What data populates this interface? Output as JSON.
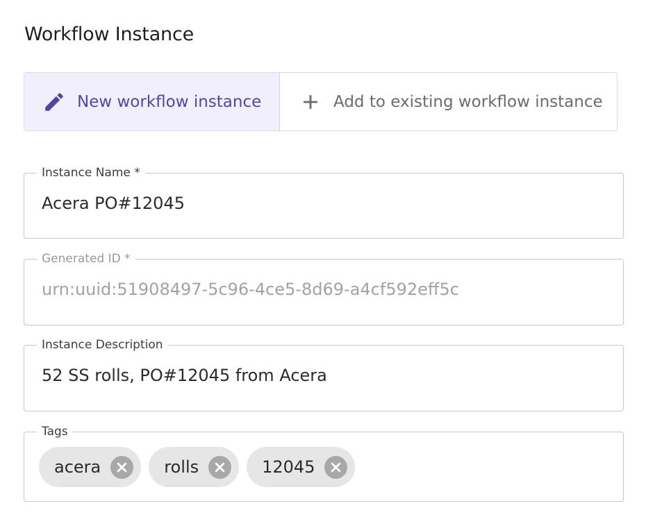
{
  "section": {
    "title": "Workflow Instance"
  },
  "mode_toggle": {
    "new_label": "New workflow instance",
    "existing_label": "Add to existing workflow instance",
    "selected": "new"
  },
  "fields": {
    "instance_name": {
      "label": "Instance Name *",
      "value": "Acera PO#12045"
    },
    "generated_id": {
      "label": "Generated ID *",
      "value": "urn:uuid:51908497-5c96-4ce5-8d69-a4cf592eff5c"
    },
    "instance_description": {
      "label": "Instance Description",
      "value": "52 SS rolls, PO#12045 from Acera"
    },
    "tags": {
      "label": "Tags",
      "items": [
        "acera",
        "rolls",
        "12045"
      ]
    }
  },
  "colors": {
    "accent": "#5644a4",
    "selected_bg": "#f1effb",
    "chip_bg": "#e6e6e6",
    "chip_delete": "#a8a8a8"
  },
  "icons": {
    "new": "pencil-icon",
    "existing": "plus-icon",
    "chip_delete": "cancel-circle-icon"
  }
}
